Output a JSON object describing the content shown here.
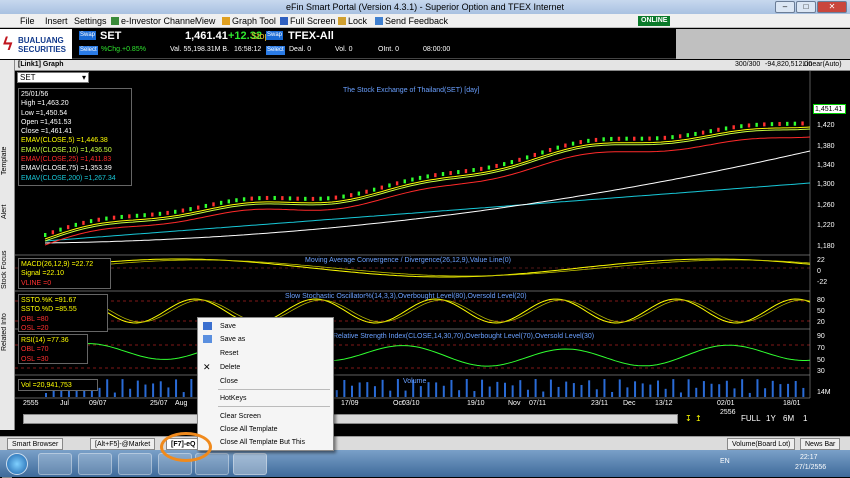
{
  "window": {
    "title": "eFin Smart Portal (Version 4.3.1) - Superior Option and TFEX Internet"
  },
  "menu": {
    "items": [
      "File",
      "Insert",
      "Settings",
      "e-Investor Channel",
      "View",
      "Graph Tool",
      "Full Screen",
      "Lock",
      "Send Feedback"
    ],
    "online": "ONLINE"
  },
  "logo": {
    "line1": "BUALUANG",
    "line2": "SECURITIES"
  },
  "ticker": {
    "swap1": "Swap",
    "symbol": "SET",
    "price": "1,461.41",
    "change": "+12.32",
    "stop": "Stop",
    "swap2": "Swap",
    "tfex": "TFEX-All",
    "select1": "Select",
    "pct": "%Chg.+0.85%",
    "value": "Val. 55,198.31M B.",
    "time": "16:58:12",
    "select2": "Select",
    "deal": "Deal. 0",
    "vol": "Vol. 0",
    "oi": "OInt. 0",
    "time2": "08:00:00"
  },
  "panel": {
    "header": "[Link1] Graph",
    "symbol_combo": "SET",
    "counts": "300/300",
    "readout": "-94,820,512.00",
    "scale": "Linear(Auto)"
  },
  "left_tabs": [
    "Template",
    "Alert",
    "Stock Focus",
    "Related Info"
  ],
  "main_chart": {
    "title": "The Stock Exchange of Thailand(SET) [day]",
    "price_tag": "1,451.41",
    "legend": {
      "date": "25/01/56",
      "high": "High  =1,463.20",
      "low": "Low   =1,450.54",
      "open": "Open  =1,451.53",
      "close": "Close =1,461.41",
      "ema5": "EMAV(CLOSE,5)   =1,446.38",
      "ema10": "EMAV(CLOSE,10)  =1,436.50",
      "ema25": "EMAV(CLOSE,25)  =1,411.83",
      "ema75": "EMAV(CLOSE,75)  =1,353.39",
      "ema200": "EMAV(CLOSE,200) =1,267.34"
    },
    "yticks": [
      "1,420",
      "1,380",
      "1,340",
      "1,300",
      "1,260",
      "1,220",
      "1,180"
    ]
  },
  "macd": {
    "title": "Moving Average Convergence / Divergence(26,12,9),Value Line(0)",
    "l1": "MACD(26,12,9) =22.72",
    "l2": "Signal  =22.10",
    "l3": "VLINE  =0",
    "yticks": [
      "22",
      "0",
      "-22"
    ]
  },
  "sto": {
    "title": "Slow Stochastic Oscillator%(14,3,3),Overbought Level(80),Oversold Level(20)",
    "l1": "SSTO.%K  =91.67",
    "l2": "SSTO.%D  =85.55",
    "l3": "OBL    =80",
    "l4": "OSL    =20",
    "yticks": [
      "80",
      "50",
      "20"
    ]
  },
  "rsi": {
    "title": "Relative Strength Index(CLOSE,14,30,70),Overbought Level(70),Oversold Level(30)",
    "l1": "RSI(14)  =77.36",
    "l2": "OBL    =70",
    "l3": "OSL    =30",
    "yticks": [
      "90",
      "70",
      "50",
      "30"
    ]
  },
  "volume": {
    "title": "Volume",
    "l1": "Vol  =20,941,753",
    "ytick": "14M"
  },
  "xaxis": {
    "labels": [
      "2555",
      "Jul",
      "09/07",
      "25/07",
      "Aug",
      "17/09",
      "Oct",
      "03/10",
      "19/10",
      "Nov",
      "07/11",
      "23/11",
      "Dec",
      "13/12",
      "02/01",
      "2556",
      "18/01"
    ]
  },
  "range_buttons": [
    "FULL",
    "1Y",
    "6M",
    "1"
  ],
  "tabs": {
    "smart_browser": "Smart Browser",
    "market": "[Alt+F5]-@Market",
    "eq": "[F7]-eQ",
    "volume": "Volume(Board Lot)",
    "news": "News Bar"
  },
  "context_menu": {
    "items": [
      "Save",
      "Save as",
      "Reset",
      "Delete",
      "Close",
      "HotKeys",
      "Clear Screen",
      "Close All Template",
      "Close All Template But This"
    ]
  },
  "clock": {
    "time": "22:17",
    "date": "27/1/2556",
    "lang": "EN"
  },
  "colors": {
    "ema5": "#ffff00",
    "ema10": "#c8ff40",
    "ema25": "#ff2a2a",
    "ema75": "#ffffff",
    "ema200": "#18c8d8",
    "accent": "#2a7be6",
    "highlight": "#f08a1c"
  }
}
